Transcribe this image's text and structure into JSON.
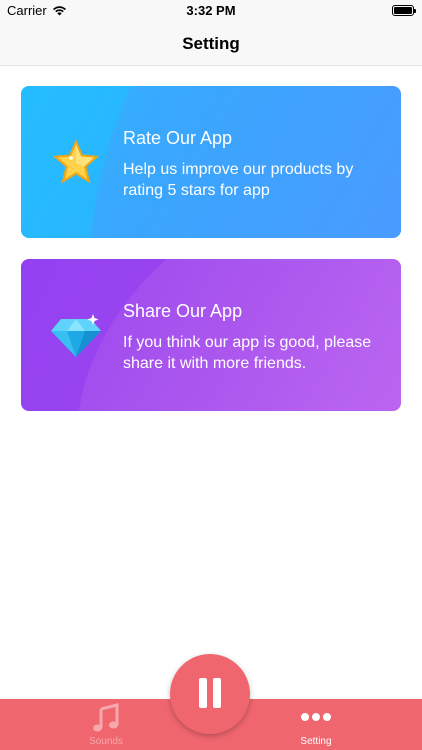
{
  "status_bar": {
    "carrier": "Carrier",
    "time": "3:32 PM"
  },
  "nav": {
    "title": "Setting"
  },
  "cards": [
    {
      "title": "Rate Our App",
      "description": "Help us improve our products by rating 5 stars for app",
      "icon": "star-icon",
      "color": "#3aa6fd"
    },
    {
      "title": "Share Our App",
      "description": "If you think our app is good, please share it with more friends.",
      "icon": "diamond-icon",
      "color": "#a652ee"
    }
  ],
  "tab_bar": {
    "color": "#f0666f",
    "tabs": [
      {
        "label": "Sounds",
        "icon": "music-note-icon",
        "selected": false
      },
      {
        "label": "Setting",
        "icon": "more-dots-icon",
        "selected": true
      }
    ],
    "center_button": {
      "icon": "pause-icon"
    }
  }
}
